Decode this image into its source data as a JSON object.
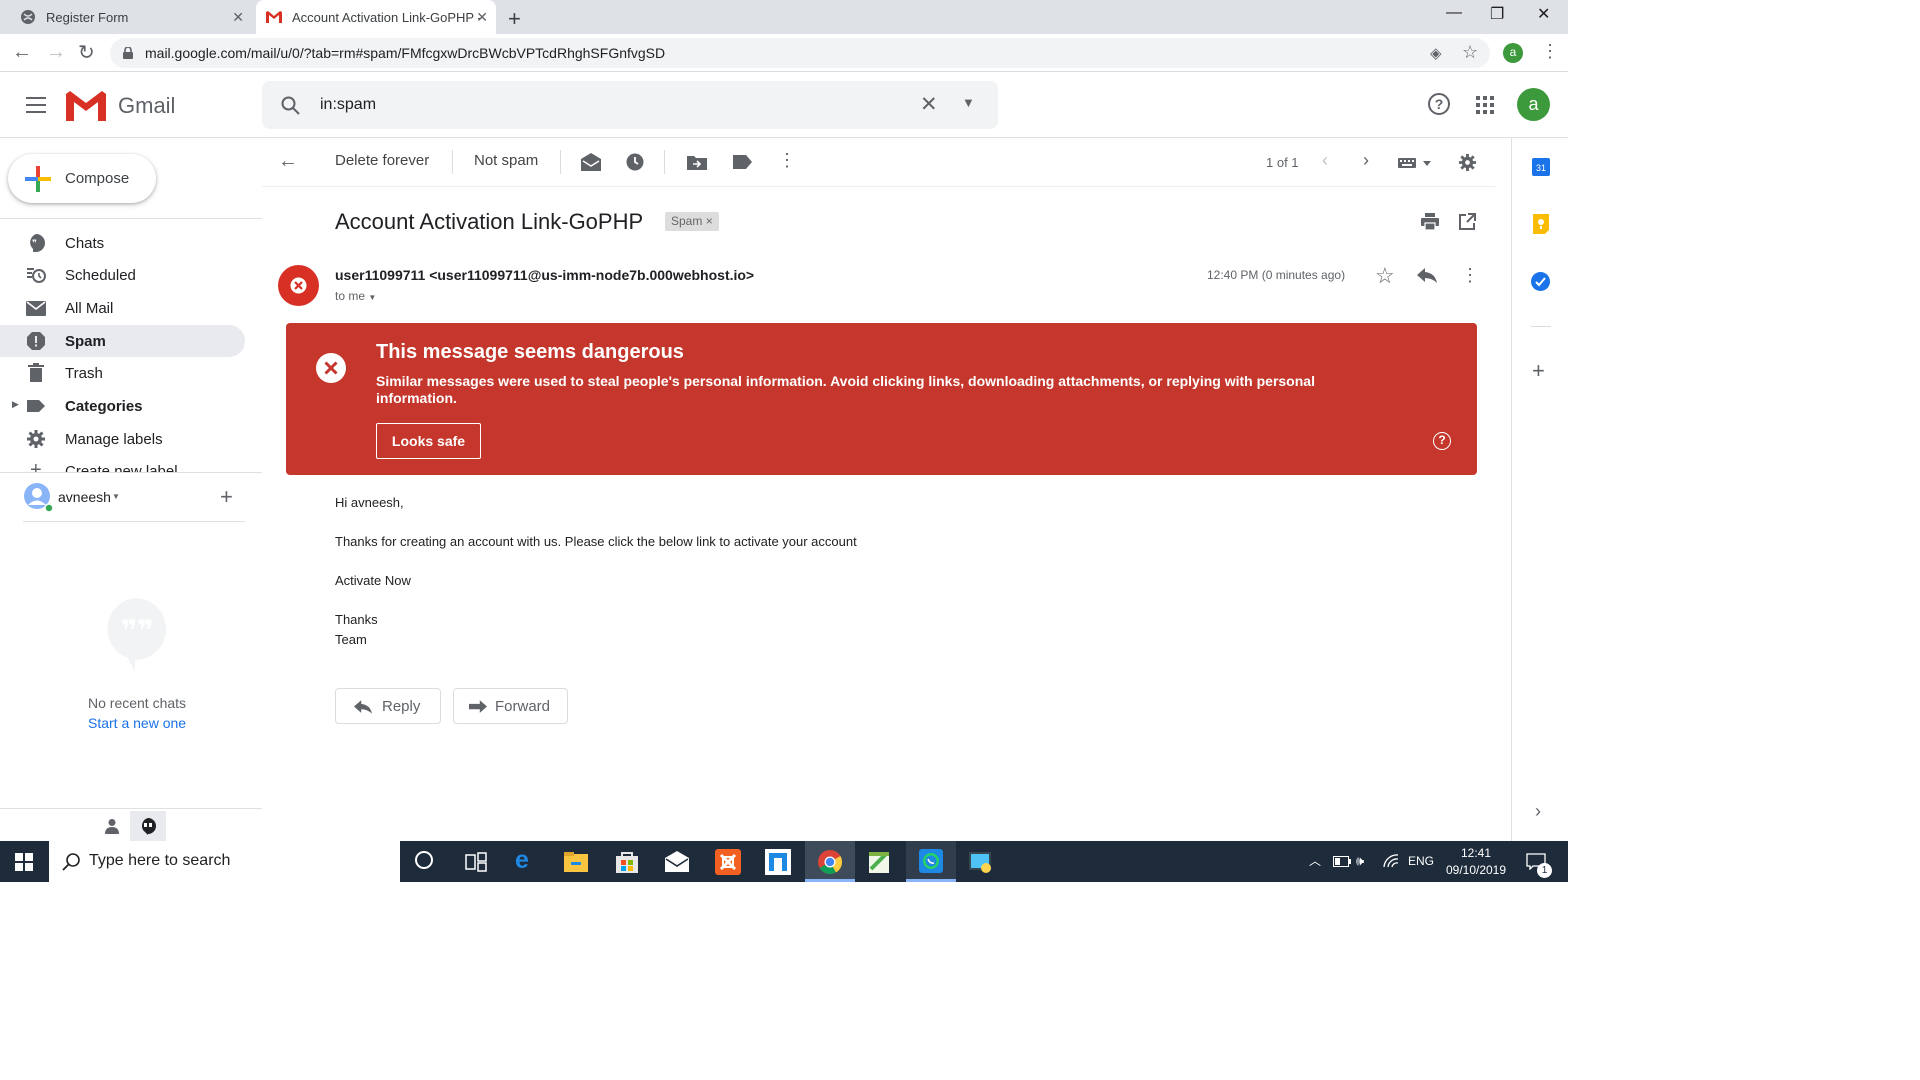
{
  "browser": {
    "tabs": [
      {
        "title": "Register Form"
      },
      {
        "title": "Account Activation Link-GoPHP -"
      }
    ],
    "url": "mail.google.com/mail/u/0/?tab=rm#spam/FMfcgxwDrcBWcbVPTcdRhghSFGnfvgSD",
    "profile_letter": "a"
  },
  "gmail": {
    "logo_text": "Gmail",
    "search_query": "in:spam",
    "avatar_letter": "a",
    "compose_label": "Compose",
    "nav": [
      {
        "label": "Chats",
        "icon": "chat-icon"
      },
      {
        "label": "Scheduled",
        "icon": "scheduled-icon"
      },
      {
        "label": "All Mail",
        "icon": "mail-icon"
      },
      {
        "label": "Spam",
        "icon": "spam-icon",
        "active": true
      },
      {
        "label": "Trash",
        "icon": "trash-icon"
      },
      {
        "label": "Categories",
        "icon": "label-icon"
      },
      {
        "label": "Manage labels",
        "icon": "gear-icon"
      },
      {
        "label": "Create new label",
        "icon": "plus-icon"
      }
    ],
    "hangouts": {
      "user": "avneesh",
      "no_chats": "No recent chats",
      "start_new": "Start a new one"
    }
  },
  "toolbar": {
    "delete_forever": "Delete forever",
    "not_spam": "Not spam",
    "pagination": "1 of 1"
  },
  "email": {
    "subject": "Account Activation Link-GoPHP",
    "chip": "Spam",
    "sender": "user11099711 <user11099711@us-imm-node7b.000webhost.io>",
    "to": "to me",
    "time": "12:40 PM (0 minutes ago)",
    "warning_title": "This message seems dangerous",
    "warning_text": "Similar messages were used to steal people's personal information. Avoid clicking links, downloading attachments, or replying with personal information.",
    "looks_safe": "Looks safe",
    "body": {
      "greeting": "Hi avneesh,",
      "line1": "Thanks for creating an account with us. Please click the below link to activate your account",
      "link": "Activate Now",
      "thanks": "Thanks",
      "team": "Team"
    },
    "reply": "Reply",
    "forward": "Forward"
  },
  "taskbar": {
    "search_placeholder": "Type here to search",
    "language": "ENG",
    "time": "12:41",
    "date": "09/10/2019",
    "notification_count": "1"
  },
  "colors": {
    "danger": "#c5372c",
    "gmail_red": "#d93025",
    "link": "#1a73e8",
    "avatar": "#3c9a3c"
  }
}
